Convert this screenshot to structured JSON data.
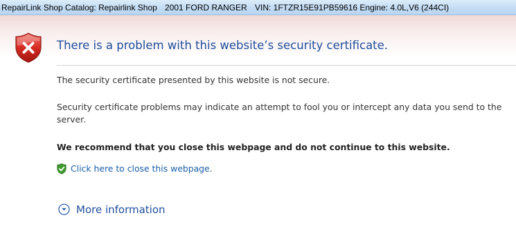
{
  "window": {
    "app_title": "RepairLink Shop Catalog: Repairlink Shop",
    "vehicle": "2001 FORD RANGER",
    "vin_engine": "VIN: 1FTZR15E91PB59616 Engine: 4.0L,V6 (244CI)"
  },
  "error_page": {
    "heading": "There is a problem with this website’s security certificate.",
    "message": "The security certificate presented by this website is not secure.",
    "explanation": "Security certificate problems may indicate an attempt to fool you or intercept any data you send to the server.",
    "recommendation": "We recommend that you close this webpage and do not continue to this website.",
    "close_link": "Click here to close this webpage.",
    "more_info": "More information"
  },
  "icons": {
    "main": "error-shield-icon",
    "close": "green-check-shield-icon",
    "expand": "chevron-down-circle-icon"
  },
  "colors": {
    "heading": "#1f4e9c",
    "link": "#1b5fa8",
    "error_red": "#d52b22",
    "safe_green": "#3e9a2c"
  }
}
